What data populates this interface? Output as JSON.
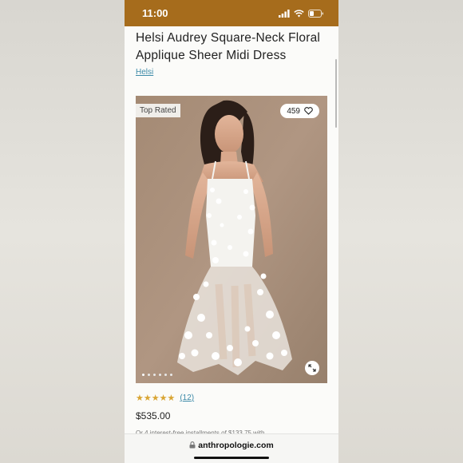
{
  "status_bar": {
    "time": "11:00"
  },
  "product": {
    "title": "Helsi Audrey Square-Neck Floral Applique Sheer Midi Dress",
    "brand": "Helsi",
    "badge": "Top Rated",
    "likes": "459",
    "rating_stars": "★★★★★",
    "rating_value": 4.5,
    "review_count": "(12)",
    "price": "$535.00",
    "installments": "Or 4 interest-free installments of $133.75 with"
  },
  "carousel": {
    "total": 6,
    "active_index": 0
  },
  "browser": {
    "url": "anthropologie.com"
  },
  "colors": {
    "status_bar": "#a66c1c",
    "link": "#3c8aa8",
    "stars": "#d9a534",
    "photo_bg": "#a58a73"
  },
  "icons": [
    "signal-icon",
    "wifi-icon",
    "battery-icon",
    "heart-icon",
    "expand-icon",
    "lock-icon"
  ]
}
